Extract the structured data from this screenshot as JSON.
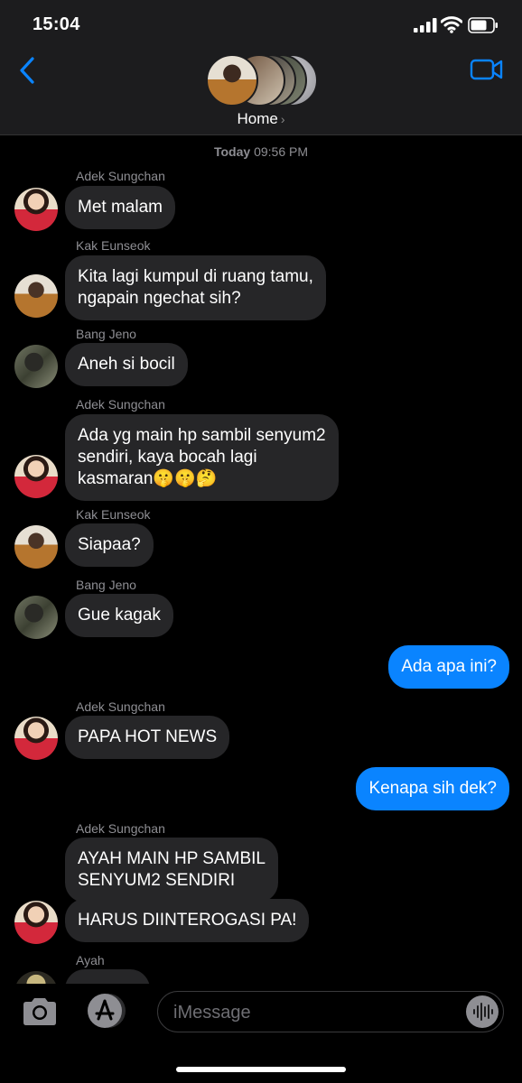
{
  "status_bar": {
    "time": "15:04"
  },
  "header": {
    "group_name": "Home",
    "chevron": "›"
  },
  "messages": {
    "timestamp_day": "Today",
    "timestamp_time": "09:56 PM",
    "items": [
      {
        "sender": "Adek Sungchan",
        "text": "Met malam"
      },
      {
        "sender": "Kak Eunseok",
        "text": "Kita lagi kumpul di ruang tamu,\nngapain ngechat sih?"
      },
      {
        "sender": "Bang Jeno",
        "text": "Aneh si bocil"
      },
      {
        "sender": "Adek Sungchan",
        "text": "Ada yg main hp sambil senyum2\nsendiri, kaya bocah lagi\nkasmaran🤫🤫🤔"
      },
      {
        "sender": "Kak Eunseok",
        "text": "Siapaa?"
      },
      {
        "sender": "Bang Jeno",
        "text": "Gue kagak"
      },
      {
        "sender": "Me",
        "text": "Ada apa ini?"
      },
      {
        "sender": "Adek Sungchan",
        "text": "PAPA HOT NEWS"
      },
      {
        "sender": "Me",
        "text": "Kenapa sih dek?"
      },
      {
        "sender": "Adek Sungchan",
        "text": "AYAH MAIN HP SAMBIL\nSENYUM2 SENDIRI"
      },
      {
        "sender": "Adek Sungchan",
        "text": "HARUS DIINTEROGASI PA!"
      },
      {
        "sender": "Ayah",
        "text": ""
      }
    ]
  },
  "input_bar": {
    "placeholder": "iMessage"
  },
  "icons": {
    "back": "chevron-left-icon",
    "video": "video-camera-icon",
    "camera": "camera-icon",
    "apps": "app-store-icon",
    "audio": "audio-waveform-icon"
  },
  "colors": {
    "accent": "#0a84ff",
    "incoming_bubble": "#262628",
    "background": "#000000"
  }
}
